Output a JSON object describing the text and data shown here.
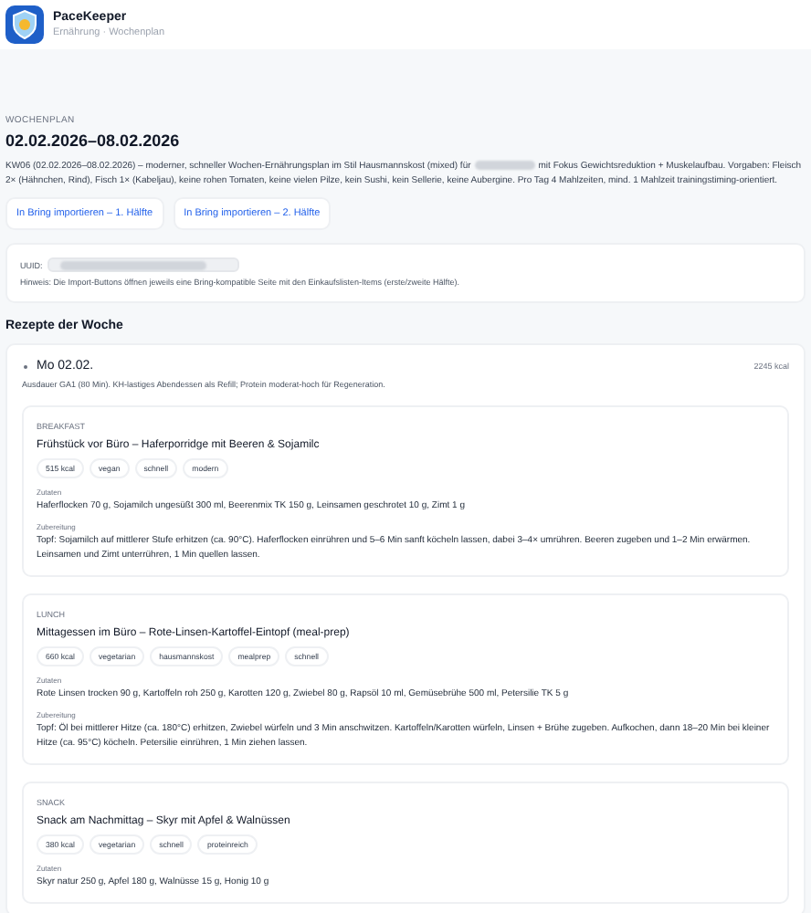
{
  "app": {
    "name": "PaceKeeper",
    "subtitle": "Ernährung · Wochenplan"
  },
  "plan": {
    "eyebrow": "WOCHENPLAN",
    "title": "02.02.2026–08.02.2026",
    "description_before": "KW06 (02.02.2026–08.02.2026) – moderner, schneller Wochen-Ernährungsplan im Stil Hausmannskost (mixed) für",
    "description_after": "mit Fokus Gewichtsreduktion + Muskelaufbau. Vorgaben: Fleisch 2× (Hähnchen, Rind), Fisch 1× (Kabeljau), keine rohen Tomaten, keine vielen Pilze, kein Sushi, kein Sellerie, keine Aubergine. Pro Tag 4 Mahlzeiten, mind. 1 Mahlzeit trainingstiming-orientiert.",
    "buttons": [
      "In Bring importieren – 1. Hälfte",
      "In Bring importieren – 2. Hälfte"
    ]
  },
  "info": {
    "uuid_label": "UUID:",
    "hint": "Hinweis: Die Import-Buttons öffnen jeweils eine Bring-kompatible Seite mit den Einkaufslisten-Items (erste/zweite Hälfte)."
  },
  "section_title": "Rezepte der Woche",
  "days": [
    {
      "name": "Mo 02.02.",
      "kcal": "2245 kcal",
      "expanded": true,
      "note": "Ausdauer GA1 (80 Min). KH-lastiges Abendessen als Refill; Protein moderat-hoch für Regeneration.",
      "meals": [
        {
          "category": "BREAKFAST",
          "title": "Frühstück vor Büro – Haferporridge mit Beeren & Sojamilc",
          "tags": [
            "515 kcal",
            "vegan",
            "schnell",
            "modern"
          ],
          "ingredients_label": "Zutaten",
          "ingredients": "Haferflocken 70 g, Sojamilch ungesüßt 300 ml, Beerenmix TK 150 g, Leinsamen geschrotet 10 g, Zimt 1 g",
          "prep_label": "Zubereitung",
          "prep": "Topf: Sojamilch auf mittlerer Stufe erhitzen (ca. 90°C). Haferflocken einrühren und 5–6 Min sanft köcheln lassen, dabei 3–4× umrühren. Beeren zugeben und 1–2 Min erwärmen. Leinsamen und Zimt unterrühren, 1 Min quellen lassen."
        },
        {
          "category": "LUNCH",
          "title": "Mittagessen im Büro – Rote-Linsen-Kartoffel-Eintopf (meal-prep)",
          "tags": [
            "660 kcal",
            "vegetarian",
            "hausmannskost",
            "mealprep",
            "schnell"
          ],
          "ingredients_label": "Zutaten",
          "ingredients": "Rote Linsen trocken 90 g, Kartoffeln roh 250 g, Karotten 120 g, Zwiebel 80 g, Rapsöl 10 ml, Gemüsebrühe 500 ml, Petersilie TK 5 g",
          "prep_label": "Zubereitung",
          "prep": "Topf: Öl bei mittlerer Hitze (ca. 180°C) erhitzen, Zwiebel würfeln und 3 Min anschwitzen. Kartoffeln/Karotten würfeln, Linsen + Brühe zugeben. Aufkochen, dann 18–20 Min bei kleiner Hitze (ca. 95°C) köcheln. Petersilie einrühren, 1 Min ziehen lassen."
        },
        {
          "category": "SNACK",
          "title": "Snack am Nachmittag – Skyr mit Apfel & Walnüssen",
          "tags": [
            "380 kcal",
            "vegetarian",
            "schnell",
            "proteinreich"
          ],
          "ingredients_label": "Zutaten",
          "ingredients": "Skyr natur 250 g, Apfel 180 g, Walnüsse 15 g, Honig 10 g"
        }
      ]
    }
  ]
}
